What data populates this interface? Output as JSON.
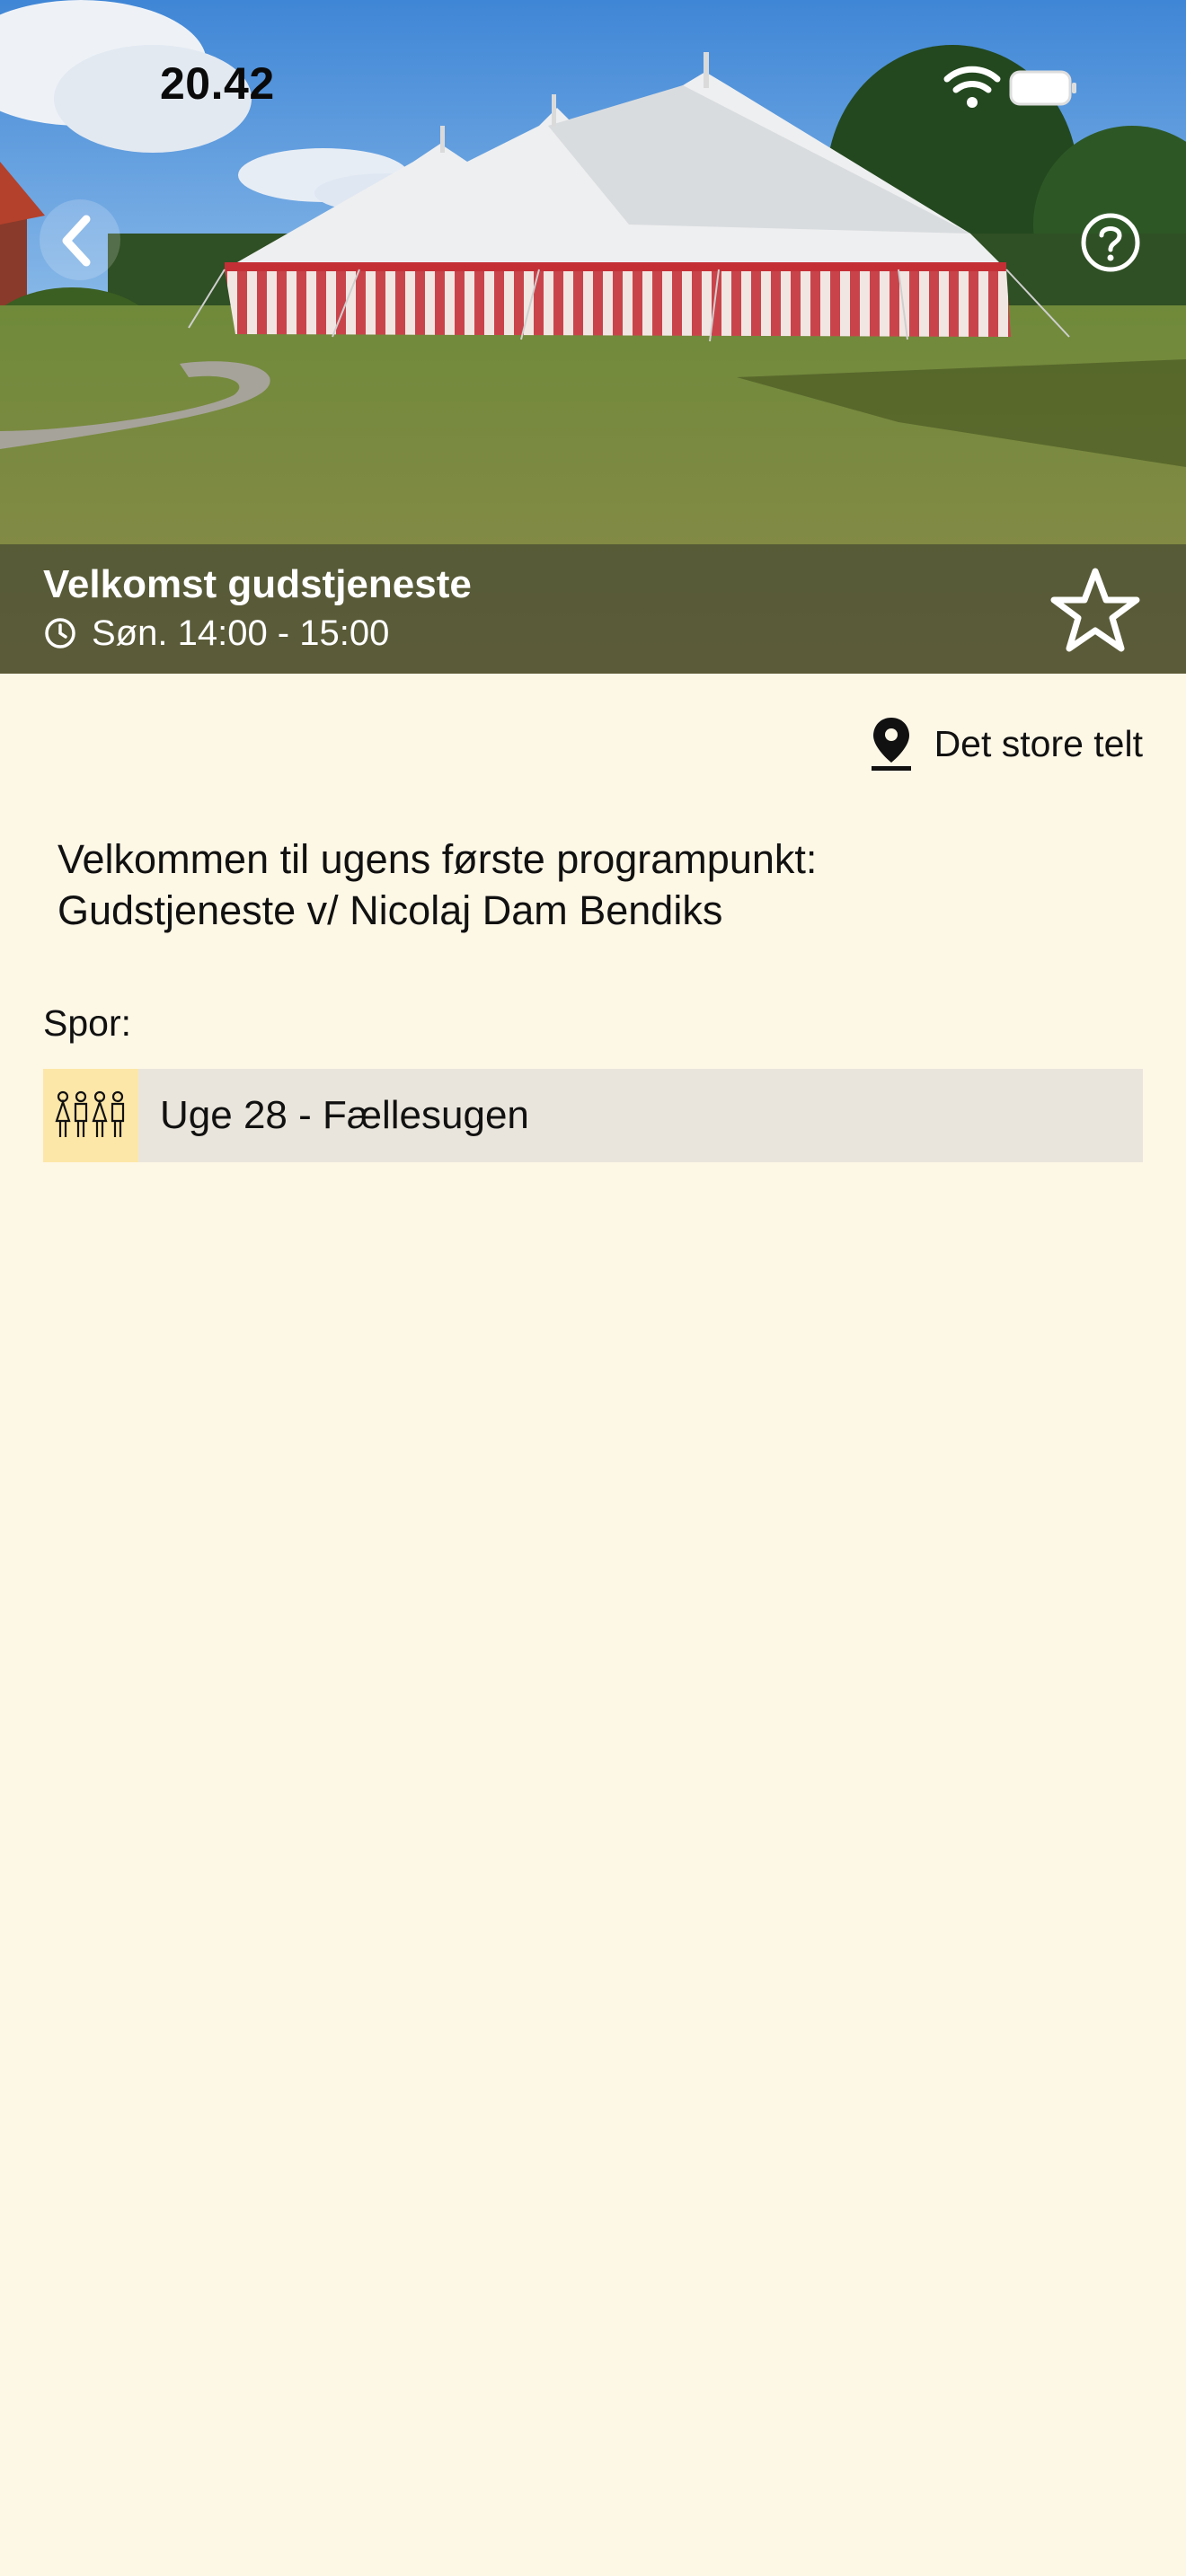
{
  "status_bar": {
    "time": "20.42",
    "icons": [
      "wifi-icon",
      "battery-icon"
    ]
  },
  "header": {
    "back_icon": "chevron-left-icon",
    "help_icon": "question-circle-icon"
  },
  "event": {
    "title": "Velkomst gudstjeneste",
    "time": "Søn. 14:00 - 15:00",
    "time_icon": "clock-icon",
    "favorite_icon": "star-outline-icon",
    "location": "Det store telt",
    "location_icon": "map-pin-icon",
    "description_line1": "Velkommen til ugens første programpunkt:",
    "description_line2": "Gudstjeneste v/ Nicolaj Dam Bendiks"
  },
  "tracks": {
    "label": "Spor:",
    "items": [
      {
        "label": "Uge 28 - Fællesugen",
        "icon": "family-icon",
        "icon_bg": "#fde7a8"
      }
    ]
  },
  "colors": {
    "background": "#fdf7e6",
    "track_row": "#e9e5dc"
  }
}
